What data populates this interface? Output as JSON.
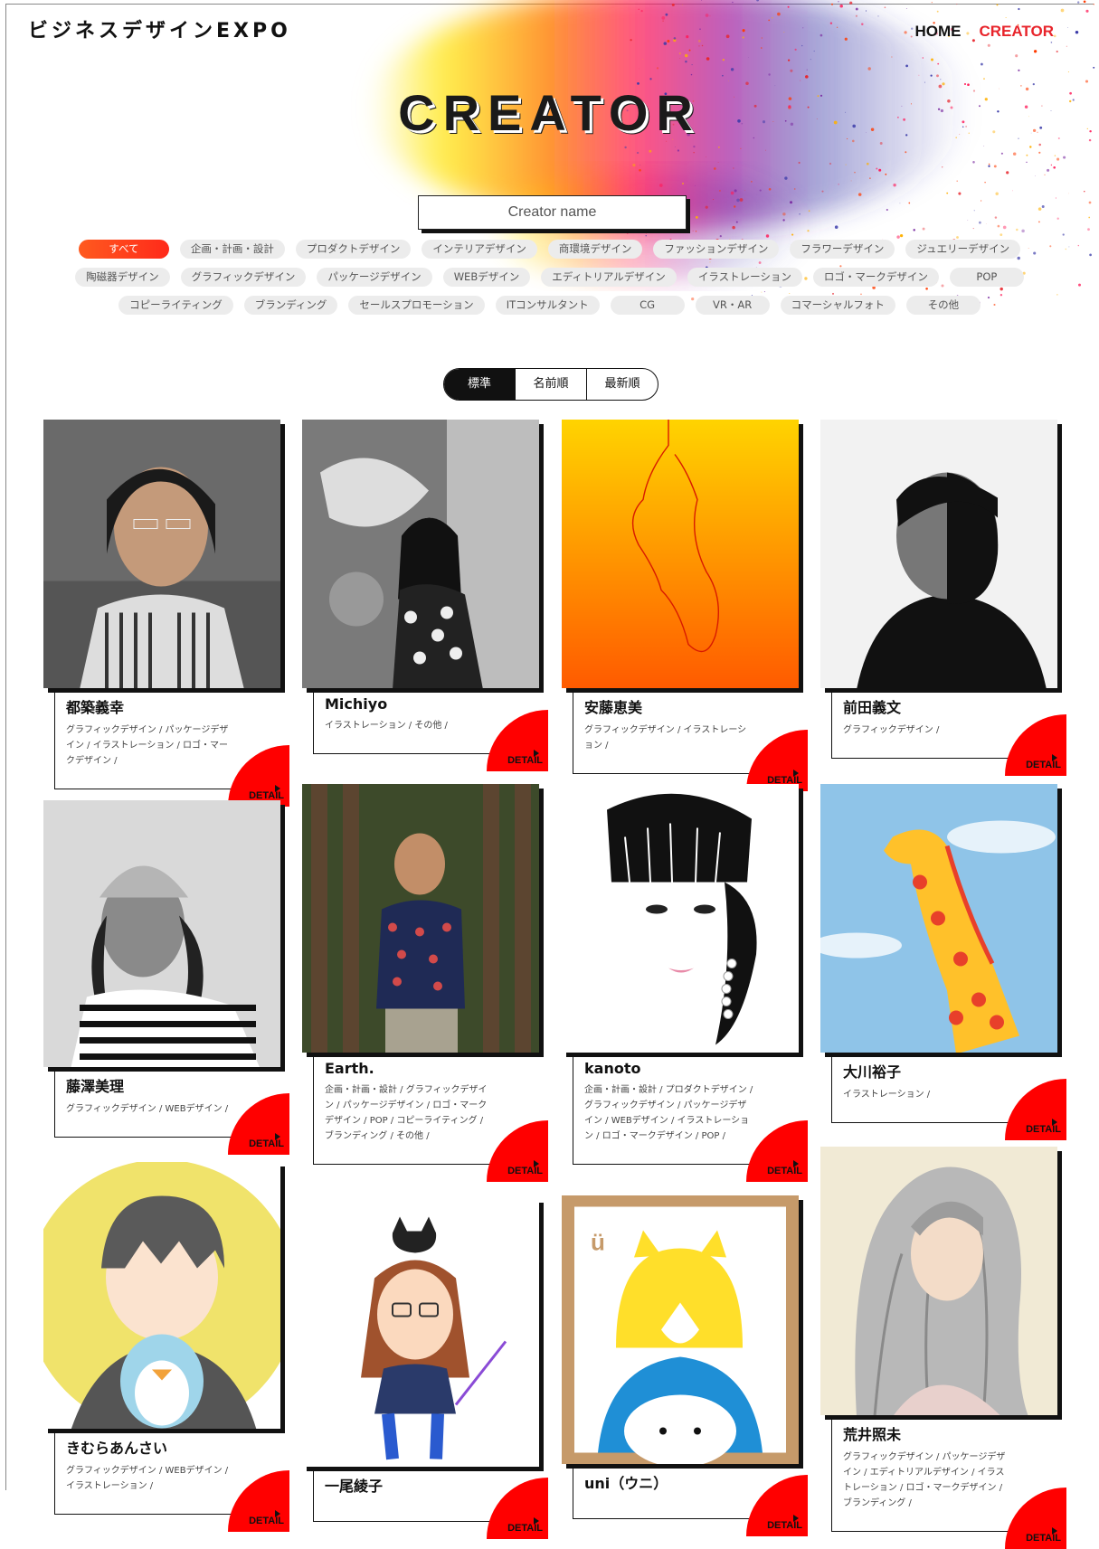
{
  "header": {
    "logo": "ビジネスデザインEXPO",
    "nav": [
      {
        "label": "HOME",
        "active": false
      },
      {
        "label": "CREATOR",
        "active": true
      }
    ],
    "accent_color": "#e8242b"
  },
  "page_title": "CREATOR",
  "search": {
    "placeholder": "Creator name",
    "value": ""
  },
  "tags": {
    "row1": [
      "すべて",
      "企画・計画・設計",
      "プロダクトデザイン",
      "インテリアデザイン",
      "商環境デザイン",
      "ファッションデザイン",
      "フラワーデザイン",
      "ジュエリーデザイン"
    ],
    "row2": [
      "陶磁器デザイン",
      "グラフィックデザイン",
      "パッケージデザイン",
      "WEBデザイン",
      "エディトリアルデザイン",
      "イラストレーション",
      "ロゴ・マークデザイン",
      "POP"
    ],
    "row3": [
      "コピーライティング",
      "ブランディング",
      "セールスプロモーション",
      "ITコンサルタント",
      "CG",
      "VR・AR",
      "コマーシャルフォト",
      "その他"
    ],
    "active": "すべて"
  },
  "sort": {
    "options": [
      "標準",
      "名前順",
      "最新順"
    ],
    "selected": "標準"
  },
  "detail_label": "DETAIL",
  "creators": [
    {
      "name": "都築義幸",
      "categories": "グラフィックデザイン / パッケージデザイン / イラストレーション / ロゴ・マークデザイン /",
      "image": "man-glasses-photo"
    },
    {
      "name": "Michiyo",
      "categories": "イラストレーション / その他 /",
      "image": "woman-artwork-photo"
    },
    {
      "name": "安藤恵美",
      "categories": "グラフィックデザイン / イラストレーション /",
      "image": "orange-line-art"
    },
    {
      "name": "前田義文",
      "categories": "グラフィックデザイン /",
      "image": "man-bw-portrait"
    },
    {
      "name": "藤澤美理",
      "categories": "グラフィックデザイン / WEBデザイン /",
      "image": "woman-knit-hat-photo"
    },
    {
      "name": "Earth.",
      "categories": "企画・計画・設計 / グラフィックデザイン / パッケージデザイン / ロゴ・マークデザイン / POP / コピーライティング / ブランディング / その他 /",
      "image": "man-forest-photo"
    },
    {
      "name": "kanoto",
      "categories": "企画・計画・設計 / プロダクトデザイン / グラフィックデザイン / パッケージデザイン / WEBデザイン / イラストレーション / ロゴ・マークデザイン / POP /",
      "image": "woman-illustration"
    },
    {
      "name": "大川裕子",
      "categories": "イラストレーション /",
      "image": "giraffe-painting"
    },
    {
      "name": "きむらあんさい",
      "categories": "グラフィックデザイン / WEBデザイン / イラストレーション /",
      "image": "boy-penguin-illustration"
    },
    {
      "name": "一尾綾子",
      "categories": "",
      "image": "woman-cat-illustration"
    },
    {
      "name": "uni（ウニ）",
      "categories": "",
      "image": "fox-stamp-illustration"
    },
    {
      "name": "荒井照未",
      "categories": "グラフィックデザイン / パッケージデザイン / エディトリアルデザイン / イラストレーション / ロゴ・マークデザイン / ブランディング /",
      "image": "watercolor-woman"
    }
  ]
}
